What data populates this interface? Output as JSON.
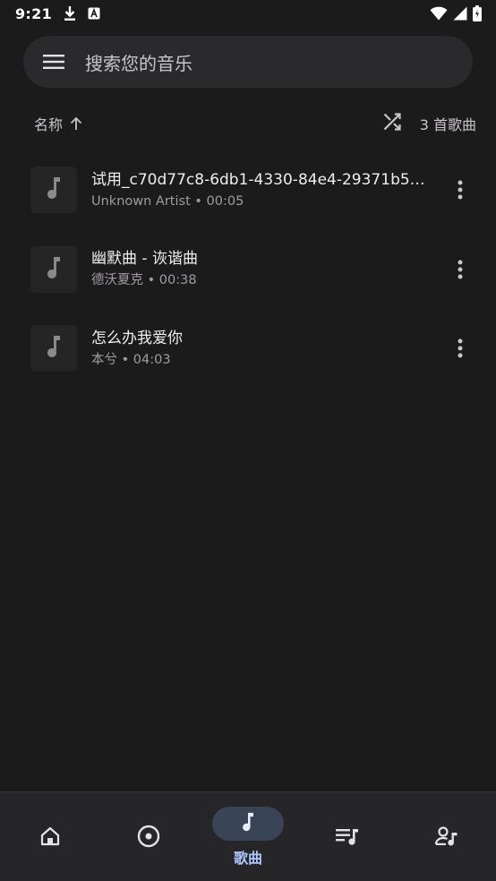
{
  "status_bar": {
    "time": "9:21"
  },
  "search": {
    "placeholder": "搜索您的音乐"
  },
  "sort": {
    "label": "名称",
    "song_count": "3 首歌曲"
  },
  "songs": [
    {
      "title": "试用_c70d77c8-6db1-4330-84e4-29371b59...",
      "subtitle": "Unknown Artist • 00:05"
    },
    {
      "title": "幽默曲 - 诙谐曲",
      "subtitle": "德沃夏克 • 00:38"
    },
    {
      "title": "怎么办我爱你",
      "subtitle": "本兮 • 04:03"
    }
  ],
  "nav": {
    "items": [
      {
        "icon": "home-icon"
      },
      {
        "icon": "album-icon"
      },
      {
        "icon": "music-note-icon",
        "label": "歌曲",
        "active": true
      },
      {
        "icon": "playlist-icon"
      },
      {
        "icon": "artist-icon"
      }
    ]
  },
  "colors": {
    "background": "#1b1b1c",
    "search_bg": "#2a2a2c",
    "accent": "#aec6ff",
    "active_pill": "#3a4457"
  }
}
